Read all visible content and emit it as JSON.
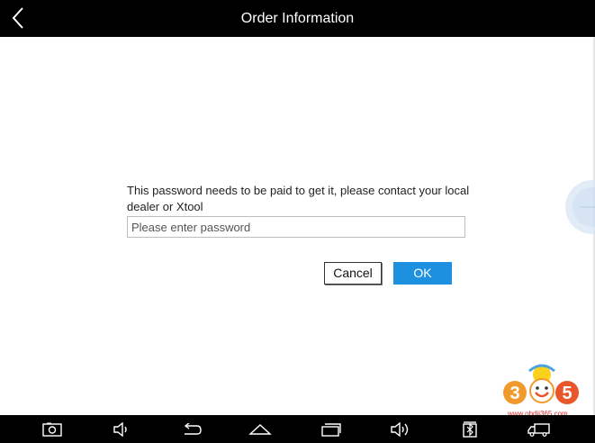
{
  "header": {
    "title": "Order Information",
    "back_icon": "chevron-left-icon"
  },
  "dialog": {
    "message": "This password needs to be paid to get it, please contact your local dealer or Xtool",
    "password_placeholder": "Please enter password",
    "password_value": "",
    "cancel_label": "Cancel",
    "ok_label": "OK"
  },
  "watermark": {
    "logo_text": "365",
    "url": "www.obdii365.com"
  },
  "navbar": {
    "icons": [
      "screenshot-icon",
      "volume-down-icon",
      "back-icon",
      "home-icon",
      "recent-apps-icon",
      "volume-up-icon",
      "vci-icon",
      "truck-icon"
    ]
  },
  "colors": {
    "header_bg": "#000000",
    "ok_button": "#1e90e0",
    "navbar_bg": "#000000"
  }
}
